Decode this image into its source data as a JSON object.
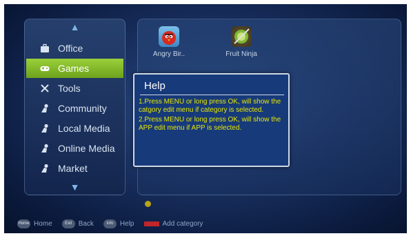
{
  "sidebar": {
    "categories": [
      {
        "label": "Office",
        "icon": "briefcase-icon"
      },
      {
        "label": "Games",
        "icon": "gamepad-icon",
        "selected": true
      },
      {
        "label": "Tools",
        "icon": "tools-icon"
      },
      {
        "label": "Community",
        "icon": "person-icon"
      },
      {
        "label": "Local Media",
        "icon": "person-icon"
      },
      {
        "label": "Online Media",
        "icon": "person-icon"
      },
      {
        "label": "Market",
        "icon": "person-icon"
      }
    ]
  },
  "apps": [
    {
      "label": "Angry Bir..",
      "icon": "angry-bird-icon"
    },
    {
      "label": "Fruit Ninja",
      "icon": "fruit-ninja-icon"
    }
  ],
  "help": {
    "title": "Help",
    "lines": [
      "1.Press MENU or long press OK, will show the catgory edit menu if category is selected.",
      "2.Press MENU or long press OK, will show the APP edit menu if APP is selected."
    ]
  },
  "page_indicator": {
    "current": 1
  },
  "footer": {
    "home": {
      "key": "Home",
      "label": "Home"
    },
    "back": {
      "key": "Exit",
      "label": "Back"
    },
    "help": {
      "key": "Info",
      "label": "Help"
    },
    "add": {
      "label": "Add category"
    }
  },
  "colors": {
    "accent": "#8cc63f",
    "help_text": "#e8e800",
    "help_bg": "#173a7a",
    "add_key": "#c3262a"
  }
}
